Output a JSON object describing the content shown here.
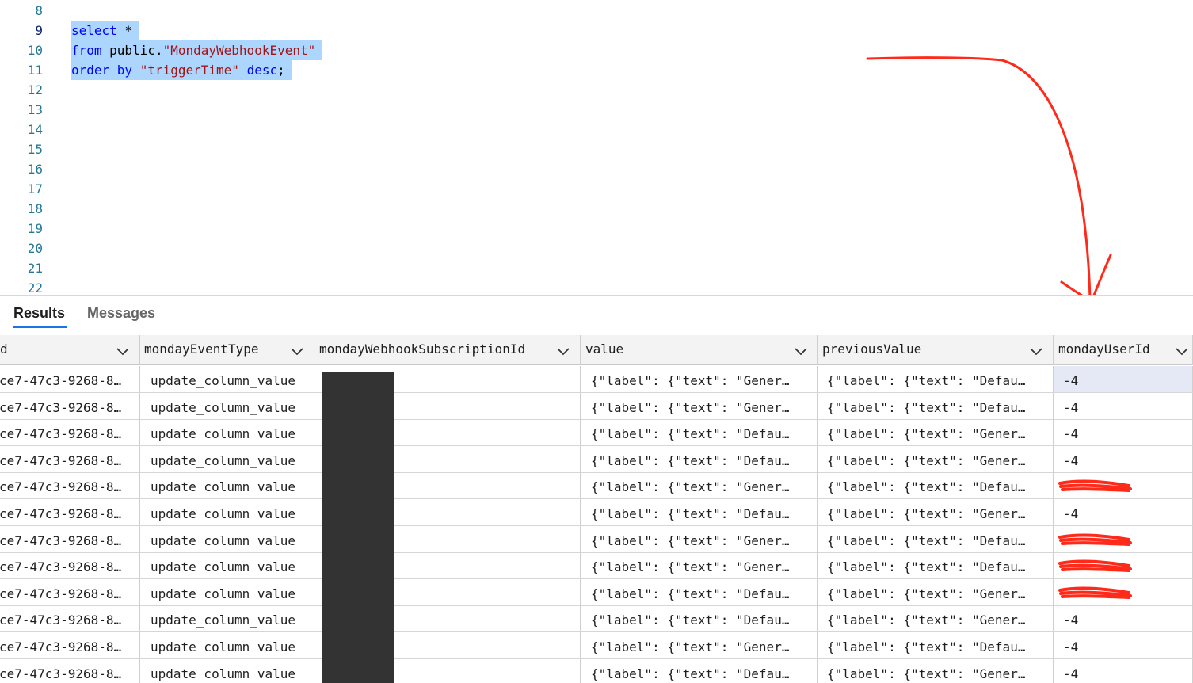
{
  "editor": {
    "line_numbers": [
      "8",
      "9",
      "10",
      "11",
      "12",
      "13",
      "14",
      "15",
      "16",
      "17",
      "18",
      "19",
      "20",
      "21",
      "22"
    ],
    "code_lines": [
      {
        "line": "9",
        "tokens": [
          {
            "t": "select",
            "c": "kw"
          },
          {
            "t": " *",
            "c": ""
          }
        ]
      },
      {
        "line": "10",
        "tokens": [
          {
            "t": "from",
            "c": "kw"
          },
          {
            "t": " public.",
            "c": ""
          },
          {
            "t": "\"MondayWebhookEvent\"",
            "c": "str"
          }
        ]
      },
      {
        "line": "11",
        "tokens": [
          {
            "t": "order by",
            "c": "kw"
          },
          {
            "t": " ",
            "c": ""
          },
          {
            "t": "\"triggerTime\"",
            "c": "str"
          },
          {
            "t": " ",
            "c": ""
          },
          {
            "t": "desc",
            "c": "kw"
          },
          {
            "t": ";",
            "c": ""
          }
        ]
      }
    ]
  },
  "tabs": {
    "results": "Results",
    "messages": "Messages"
  },
  "grid": {
    "columns": [
      {
        "key": "id",
        "label": "d"
      },
      {
        "key": "mondayEventType",
        "label": "mondayEventType"
      },
      {
        "key": "mondayWebhookSubscriptionId",
        "label": "mondayWebhookSubscriptionId"
      },
      {
        "key": "value",
        "label": "value"
      },
      {
        "key": "previousValue",
        "label": "previousValue"
      },
      {
        "key": "mondayUserId",
        "label": "mondayUserId"
      }
    ],
    "rows": [
      {
        "id": "ce7-47c3-9268-8…",
        "type": "update_column_value",
        "value": "{\"label\": {\"text\": \"Gener…",
        "prev": "{\"label\": {\"text\": \"Defau…",
        "user": "-4",
        "redacted": false
      },
      {
        "id": "ce7-47c3-9268-8…",
        "type": "update_column_value",
        "value": "{\"label\": {\"text\": \"Gener…",
        "prev": "{\"label\": {\"text\": \"Defau…",
        "user": "-4",
        "redacted": false
      },
      {
        "id": "ce7-47c3-9268-8…",
        "type": "update_column_value",
        "value": "{\"label\": {\"text\": \"Defau…",
        "prev": "{\"label\": {\"text\": \"Gener…",
        "user": "-4",
        "redacted": false
      },
      {
        "id": "ce7-47c3-9268-8…",
        "type": "update_column_value",
        "value": "{\"label\": {\"text\": \"Defau…",
        "prev": "{\"label\": {\"text\": \"Gener…",
        "user": "-4",
        "redacted": false
      },
      {
        "id": "ce7-47c3-9268-8…",
        "type": "update_column_value",
        "value": "{\"label\": {\"text\": \"Gener…",
        "prev": "{\"label\": {\"text\": \"Defau…",
        "user": "",
        "redacted": true
      },
      {
        "id": "ce7-47c3-9268-8…",
        "type": "update_column_value",
        "value": "{\"label\": {\"text\": \"Defau…",
        "prev": "{\"label\": {\"text\": \"Gener…",
        "user": "-4",
        "redacted": false
      },
      {
        "id": "ce7-47c3-9268-8…",
        "type": "update_column_value",
        "value": "{\"label\": {\"text\": \"Gener…",
        "prev": "{\"label\": {\"text\": \"Defau…",
        "user": "",
        "redacted": true
      },
      {
        "id": "ce7-47c3-9268-8…",
        "type": "update_column_value",
        "value": "{\"label\": {\"text\": \"Gener…",
        "prev": "{\"label\": {\"text\": \"Defau…",
        "user": "",
        "redacted": true
      },
      {
        "id": "ce7-47c3-9268-8…",
        "type": "update_column_value",
        "value": "{\"label\": {\"text\": \"Defau…",
        "prev": "{\"label\": {\"text\": \"Gener…",
        "user": "",
        "redacted": true
      },
      {
        "id": "ce7-47c3-9268-8…",
        "type": "update_column_value",
        "value": "{\"label\": {\"text\": \"Defau…",
        "prev": "{\"label\": {\"text\": \"Gener…",
        "user": "-4",
        "redacted": false
      },
      {
        "id": "ce7-47c3-9268-8…",
        "type": "update_column_value",
        "value": "{\"label\": {\"text\": \"Gener…",
        "prev": "{\"label\": {\"text\": \"Defau…",
        "user": "-4",
        "redacted": false
      },
      {
        "id": "ce7-47c3-9268-8…",
        "type": "update_column_value",
        "value": "{\"label\": {\"text\": \"Defau…",
        "prev": "{\"label\": {\"text\": \"Gener…",
        "user": "-4",
        "redacted": false
      }
    ]
  },
  "colors": {
    "selection": "#add6ff",
    "keyword": "#0000ff",
    "string": "#a31515",
    "line_number": "#237893",
    "annotation": "#ff2a1a",
    "redaction": "#333333"
  },
  "icons": [
    "chevron-down-icon",
    "red-arrow-annotation",
    "red-scribble-redaction"
  ]
}
